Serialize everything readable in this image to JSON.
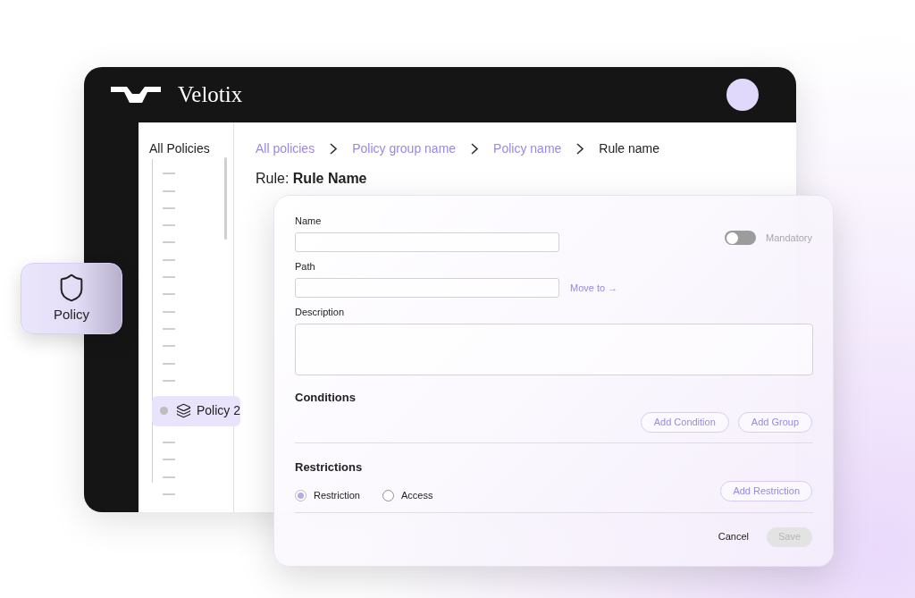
{
  "app": {
    "brand": "Velotix"
  },
  "tree": {
    "title": "All Policies",
    "item": {
      "label": "Policy 2"
    }
  },
  "breadcrumbs": [
    {
      "label": "All policies",
      "current": false
    },
    {
      "label": "Policy group name",
      "current": false
    },
    {
      "label": "Policy name",
      "current": false
    },
    {
      "label": "Rule name",
      "current": true
    }
  ],
  "heading": {
    "prefix": "Rule:",
    "name": "Rule Name"
  },
  "badge": {
    "label": "Policy"
  },
  "dialog": {
    "name": {
      "label": "Name"
    },
    "mandatory": {
      "label": "Mandatory",
      "on": false
    },
    "path": {
      "label": "Path",
      "link": "Move to →"
    },
    "description": {
      "label": "Description"
    },
    "conditions": {
      "title": "Conditions",
      "buttons": [
        "Add Condition",
        "Add Group"
      ]
    },
    "restrictions": {
      "title": "Restrictions",
      "options": [
        {
          "label": "Restriction",
          "selected": true
        },
        {
          "label": "Access",
          "selected": false
        }
      ],
      "button": "Add Restriction"
    },
    "cancel": "Cancel",
    "save": {
      "label": "Save",
      "disabled": true
    }
  }
}
